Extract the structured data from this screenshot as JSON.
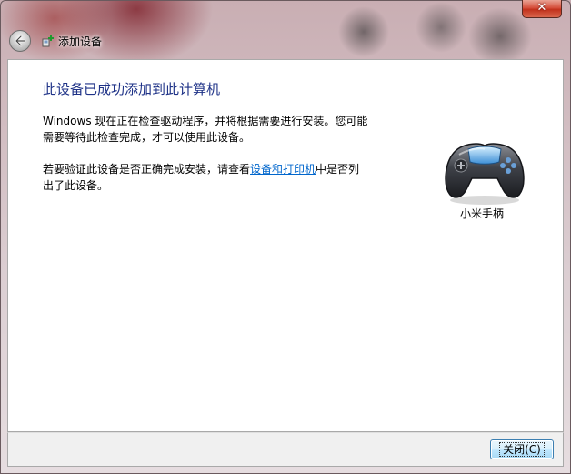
{
  "window": {
    "title": "添加设备",
    "close_label": "✕"
  },
  "content": {
    "heading": "此设备已成功添加到此计算机",
    "paragraph1": "Windows 现在正在检查驱动程序，并将根据需要进行安装。您可能需要等待此检查完成，才可以使用此设备。",
    "paragraph2_before": "若要验证此设备是否正确完成安装，请查看",
    "paragraph2_link": "设备和打印机",
    "paragraph2_after": "中是否列出了此设备。"
  },
  "device": {
    "name": "小米手柄",
    "icon": "gamepad-icon"
  },
  "footer": {
    "close_button_label": "关闭(C)"
  },
  "colors": {
    "heading": "#1e3287",
    "link": "#0066cc",
    "close_button": "#c1311c"
  }
}
